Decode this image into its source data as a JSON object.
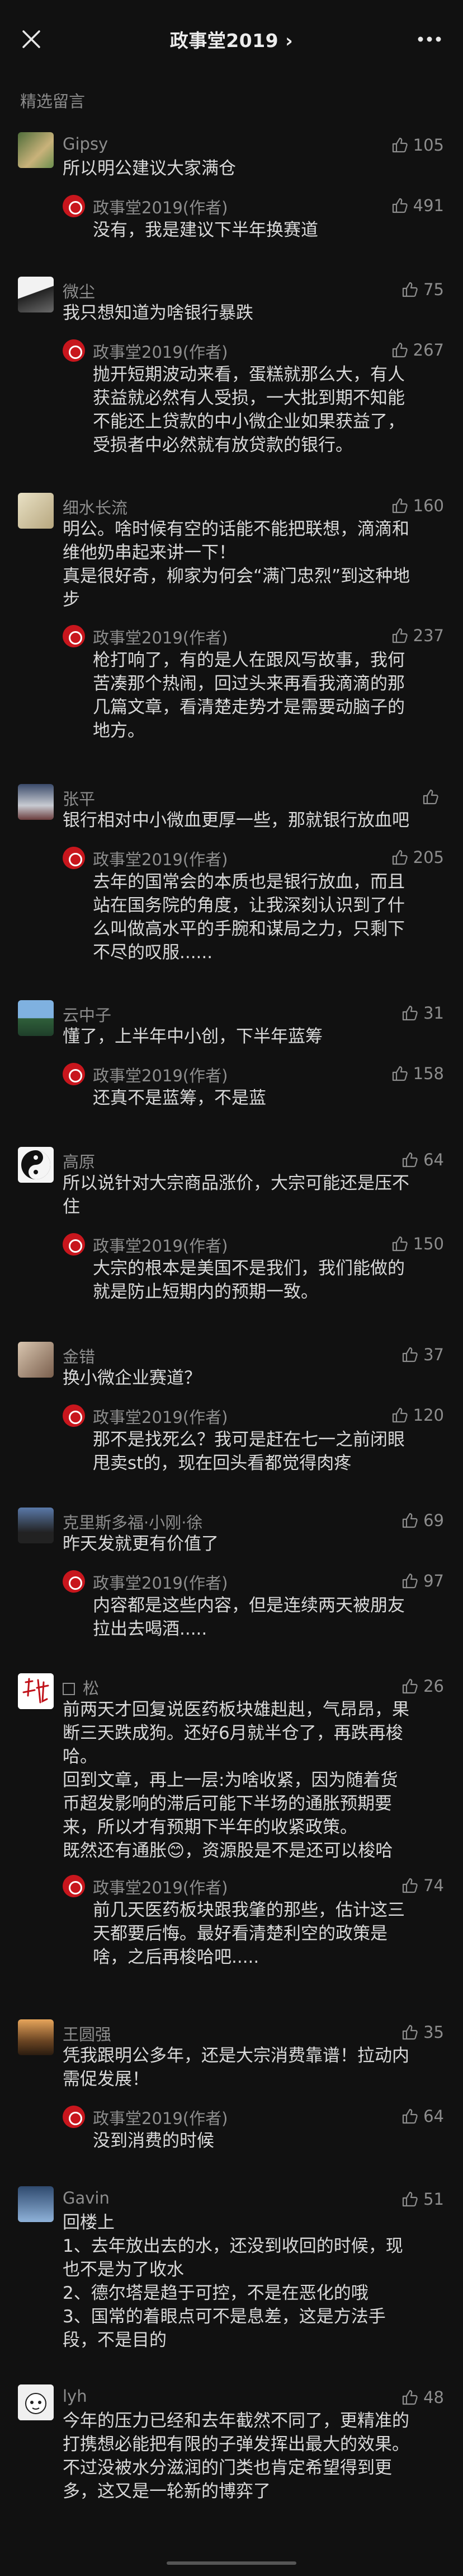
{
  "nav": {
    "title": "政事堂2019 ›"
  },
  "section": {
    "label": "精选留言"
  },
  "author_name": "政事堂2019(作者)",
  "comments": [
    {
      "name": "Gipsy",
      "likes": "105",
      "text": "所以明公建议大家满仓",
      "reply": {
        "likes": "491",
        "text": "没有，我是建议下半年换赛道"
      }
    },
    {
      "name": "微尘",
      "likes": "75",
      "text": "我只想知道为啥银行暴跌",
      "reply": {
        "likes": "267",
        "text": "抛开短期波动来看，蛋糕就那么大，有人\n获益就必然有人受损，一大批到期不知能\n不能还上贷款的中小微企业如果获益了，\n受损者中必然就有放贷款的银行。"
      }
    },
    {
      "name": "细水长流",
      "likes": "160",
      "text": "明公。啥时候有空的话能不能把联想，滴滴和\n维他奶串起来讲一下！\n真是很好奇，柳家为何会“满门忠烈”到这种地\n步",
      "reply": {
        "likes": "237",
        "text": "枪打响了，有的是人在跟风写故事，我何\n苦凑那个热闹，回过头来再看我滴滴的那\n几篇文章，看清楚走势才是需要动脑子的\n地方。"
      }
    },
    {
      "name": "张平",
      "likes": "",
      "text": "银行相对中小微血更厚一些，那就银行放血吧",
      "reply": {
        "likes": "205",
        "text": "去年的国常会的本质也是银行放血，而且\n站在国务院的角度，让我深刻认识到了什\n么叫做高水平的手腕和谋局之力，只剩下\n不尽的叹服......"
      }
    },
    {
      "name": "云中子",
      "likes": "31",
      "text": "懂了，上半年中小创，下半年蓝筹",
      "reply": {
        "likes": "158",
        "text": "还真不是蓝筹，不是蓝"
      }
    },
    {
      "name": "高原",
      "likes": "64",
      "text": "所以说针对大宗商品涨价，大宗可能还是压不\n住",
      "reply": {
        "likes": "150",
        "text": "大宗的根本是美国不是我们，我们能做的\n就是防止短期内的预期一致。"
      }
    },
    {
      "name": "金错",
      "likes": "37",
      "text": "换小微企业赛道？",
      "reply": {
        "likes": "120",
        "text": "那不是找死么？我可是赶在七一之前闭眼\n甩卖st的，现在回头看都觉得肉疼"
      }
    },
    {
      "name": "克里斯多福·小刚·徐",
      "likes": "69",
      "text": "昨天发就更有价值了",
      "reply": {
        "likes": "97",
        "text": "内容都是这些内容，但是连续两天被朋友\n拉出去喝酒....."
      }
    },
    {
      "name": "松",
      "likes": "26",
      "text": "前两天才回复说医药板块雄赳赳，气昂昂，果\n断三天跌成狗。还好6月就半仓了，再跌再梭\n哈。\n回到文章，再上一层:为啥收紧，因为随着货\n币超发影响的滞后可能下半场的通胀预期要\n来，所以才有预期下半年的收紧政策。\n既然还有通胀😊，资源股是不是还可以梭哈",
      "reply": {
        "likes": "74",
        "text": "前几天医药板块跟我肇的那些，估计这三\n天都要后悔。最好看清楚利空的政策是\n啥，之后再梭哈吧....."
      }
    },
    {
      "name": "王圆强",
      "likes": "35",
      "text": "凭我跟明公多年，还是大宗消费靠谱！拉动内\n需促发展！",
      "reply": {
        "likes": "64",
        "text": "没到消费的时候"
      }
    },
    {
      "name": "Gavin",
      "likes": "51",
      "text": "回楼上\n1、去年放出去的水，还没到收回的时候，现\n也不是为了收水\n2、德尔塔是趋于可控，不是在恶化的哦\n3、国常的着眼点可不是息差，这是方法手\n段，不是目的"
    },
    {
      "name": "lyh",
      "likes": "48",
      "text": "今年的压力已经和去年截然不同了，更精准的\n打携想必能把有限的子弹发挥出最大的效果。\n不过没被水分滋润的门类也肯定希望得到更\n多，这又是一轮新的博弈了"
    }
  ]
}
